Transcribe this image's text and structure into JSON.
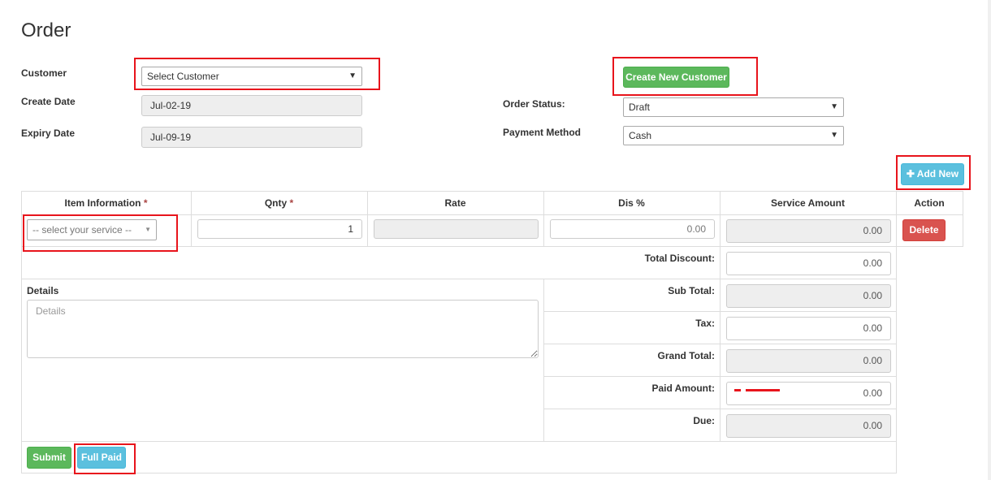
{
  "page": {
    "title": "Order"
  },
  "form": {
    "customer_label": "Customer",
    "customer_value": "Select Customer",
    "create_customer_label": "Create New Customer",
    "create_date_label": "Create Date",
    "create_date_value": "Jul-02-19",
    "expiry_date_label": "Expiry Date",
    "expiry_date_value": "Jul-09-19",
    "order_status_label": "Order Status:",
    "order_status_value": "Draft",
    "payment_method_label": "Payment Method",
    "payment_method_value": "Cash",
    "add_new_label": "Add New"
  },
  "table": {
    "headers": {
      "item": "Item Information",
      "qnty": "Qnty",
      "rate": "Rate",
      "dis": "Dis %",
      "service_amount": "Service Amount",
      "action": "Action"
    },
    "required_mark": "*",
    "row": {
      "service_value": "-- select your service --",
      "qnty": "1",
      "rate": "",
      "dis": "0.00",
      "service_amount": "0.00",
      "delete_label": "Delete"
    }
  },
  "details": {
    "label": "Details",
    "placeholder": "Details"
  },
  "totals": {
    "total_discount_label": "Total Discount:",
    "total_discount": "0.00",
    "sub_total_label": "Sub Total:",
    "sub_total": "0.00",
    "tax_label": "Tax:",
    "tax": "0.00",
    "grand_total_label": "Grand Total:",
    "grand_total": "0.00",
    "paid_amount_label": "Paid Amount:",
    "paid_amount": "0.00",
    "due_label": "Due:",
    "due": "0.00"
  },
  "footer": {
    "submit_label": "Submit",
    "full_paid_label": "Full Paid"
  },
  "colors": {
    "annotation": "#e8141c",
    "success": "#5cb85c",
    "info": "#5bc0de",
    "danger": "#d9534f"
  }
}
